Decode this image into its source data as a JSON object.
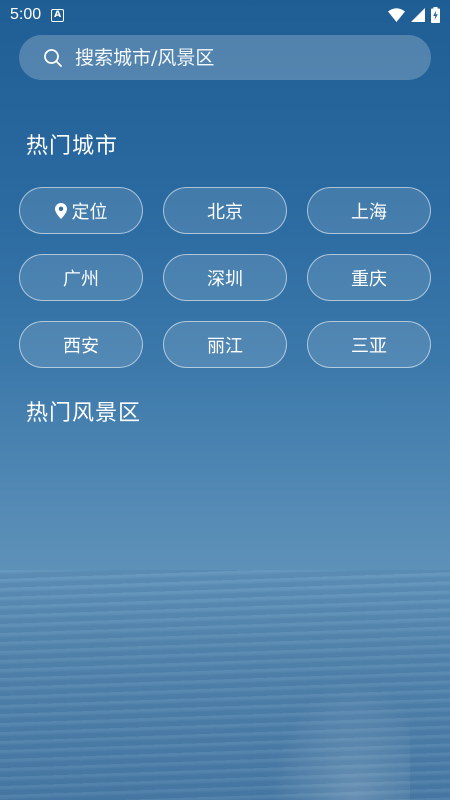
{
  "status_bar": {
    "time": "5:00",
    "notification_icon": "a-app-icon",
    "icons": [
      "wifi-icon",
      "signal-icon",
      "battery-charging-icon"
    ]
  },
  "search": {
    "placeholder": "搜索城市/风景区",
    "value": ""
  },
  "hot_cities": {
    "title": "热门城市",
    "items": [
      {
        "label": "定位",
        "icon": "location-pin-icon"
      },
      {
        "label": "北京"
      },
      {
        "label": "上海"
      },
      {
        "label": "广州"
      },
      {
        "label": "深圳"
      },
      {
        "label": "重庆"
      },
      {
        "label": "西安"
      },
      {
        "label": "丽江"
      },
      {
        "label": "三亚"
      }
    ]
  },
  "hot_scenic": {
    "title": "热门风景区"
  },
  "colors": {
    "background_top": "#1f5e95",
    "background_bottom": "#4d7fa8",
    "text": "#ffffff"
  }
}
